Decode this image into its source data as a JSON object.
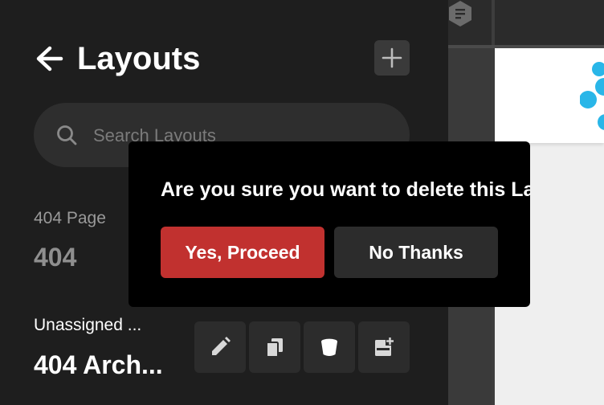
{
  "sidebar": {
    "back_icon": "arrow-left-icon",
    "title": "Layouts",
    "add_icon": "plus-icon",
    "search": {
      "placeholder": "Search Layouts",
      "value": ""
    },
    "items": [
      {
        "subtitle": "404 Page",
        "name": "404"
      },
      {
        "subtitle": "Unassigned ...",
        "name": "404 Arch..."
      }
    ],
    "item_actions": [
      "pencil-icon",
      "duplicate-icon",
      "bucket-icon",
      "add-to-page-icon"
    ]
  },
  "dialog": {
    "message": "Are you sure you want to delete this Layout?",
    "confirm_label": "Yes, Proceed",
    "cancel_label": "No Thanks"
  },
  "canvas": {
    "badge_icon": "document-hex-icon"
  },
  "colors": {
    "sidebar_bg": "#1e1e1e",
    "dialog_bg": "#000000",
    "confirm": "#c1312f",
    "secondary": "#2c2c2c",
    "logo_accent": "#29b6e8"
  }
}
